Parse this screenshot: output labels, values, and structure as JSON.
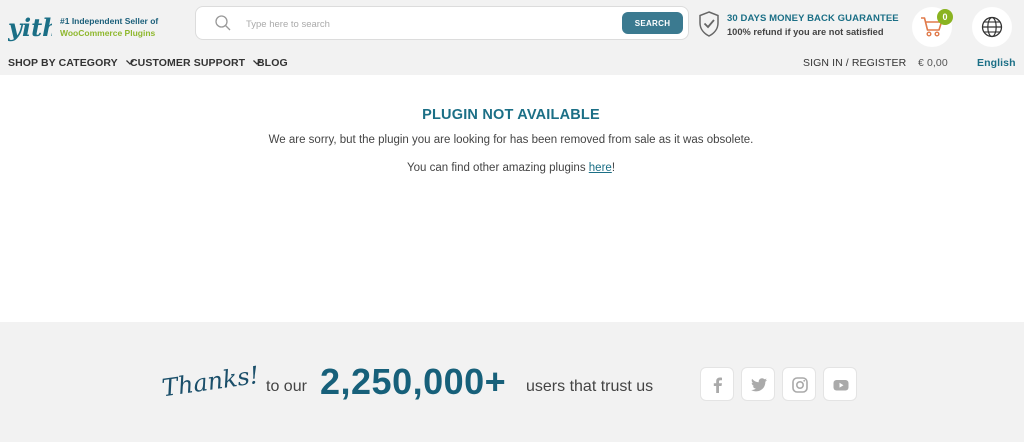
{
  "header": {
    "logo_text": "yith",
    "tagline_line1": "#1 Independent Seller of",
    "tagline_line2": "WooCommerce Plugins",
    "search_placeholder": "Type here to search",
    "search_button": "SEARCH",
    "guarantee_title": "30 DAYS MONEY BACK GUARANTEE",
    "guarantee_subtitle": "100% refund if you are not satisfied",
    "cart_count": "0",
    "accent_color": "#1b6f86",
    "brand_green": "#8ab321"
  },
  "nav": {
    "shop_by_category": "SHOP BY CATEGORY",
    "customer_support": "CUSTOMER SUPPORT",
    "blog": "BLOG",
    "sign_in": "SIGN IN / REGISTER",
    "cart_total": "€ 0,00",
    "language": "English"
  },
  "main": {
    "title": "PLUGIN NOT AVAILABLE",
    "message": "We are sorry, but the plugin you are looking for has been removed from sale as it was obsolete.",
    "find_prefix": "You can find other amazing plugins ",
    "find_link": "here",
    "find_suffix": "!"
  },
  "footer": {
    "thanks": "Thanks!",
    "to_our": "to our",
    "user_count": "2,250,000+",
    "trust_text": "users that trust us",
    "social": [
      "facebook-icon",
      "twitter-icon",
      "instagram-icon",
      "youtube-icon"
    ]
  }
}
